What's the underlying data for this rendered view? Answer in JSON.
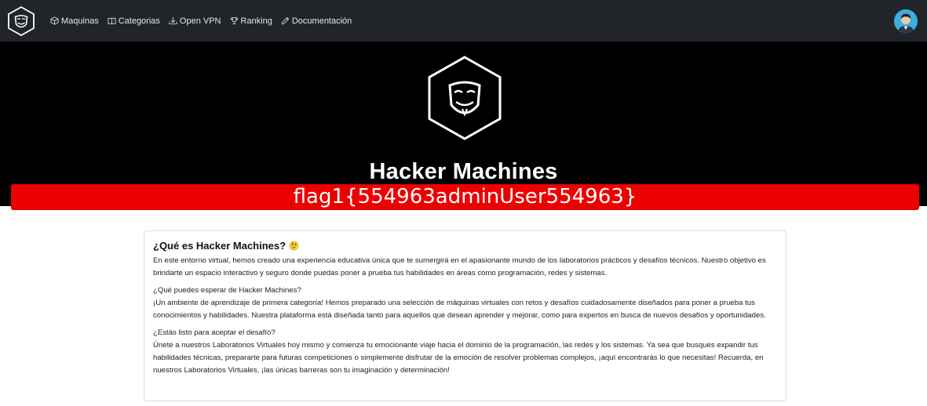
{
  "nav": {
    "items": [
      {
        "label": "Maquinas",
        "icon": "cube-icon"
      },
      {
        "label": "Categorias",
        "icon": "book-icon"
      },
      {
        "label": "Open VPN",
        "icon": "download-icon"
      },
      {
        "label": "Ranking",
        "icon": "trophy-icon"
      },
      {
        "label": "Documentación",
        "icon": "pencil-icon"
      }
    ]
  },
  "hero": {
    "title": "Hacker Machines",
    "flag": "flag1{554963adminUser554963}"
  },
  "card": {
    "title": "¿Qué es Hacker Machines?",
    "title_emoji": "thinking-face-icon",
    "p1": "En este entorno virtual, hemos creado una experiencia educativa única que te sumergirá en el apasionante mundo de los laboratorios prácticos y desafíos técnicos. Nuestro objetivo es brindarte un espacio interactivo y seguro donde puedas poner a prueba tus habilidades en áreas como programación, redes y sistemas.",
    "p2_heading": "¿Qué puedes esperar de Hacker Machines?",
    "p2_body": "¡Un ambiente de aprendizaje de primera categoría! Hemos preparado una selección de máquinas virtuales con retos y desafíos cuidadosamente diseñados para poner a prueba tus conocimientos y habilidades. Nuestra plataforma está diseñada tanto para aquellos que desean aprender y mejorar, como para expertos en busca de nuevos desafíos y oportunidades.",
    "p3_heading": "¿Estás listo para aceptar el desafío?",
    "p3_body": "Únete a nuestros Laboratorios Virtuales hoy mismo y comienza tu emocionante viaje hacia el dominio de la programación, las redes y los sistemas. Ya sea que busques expandir tus habilidades técnicas, prepararte para futuras competiciones o simplemente disfrutar de la emoción de resolver problemas complejos, ¡aquí encontrarás lo que necesitas! Recuerda, en nuestros Laboratorios Virtuales, ¡las únicas barreras son tu imaginación y determinación!"
  },
  "colors": {
    "navbar": "#212529",
    "hero": "#000000",
    "flag_banner": "#ec0000"
  }
}
